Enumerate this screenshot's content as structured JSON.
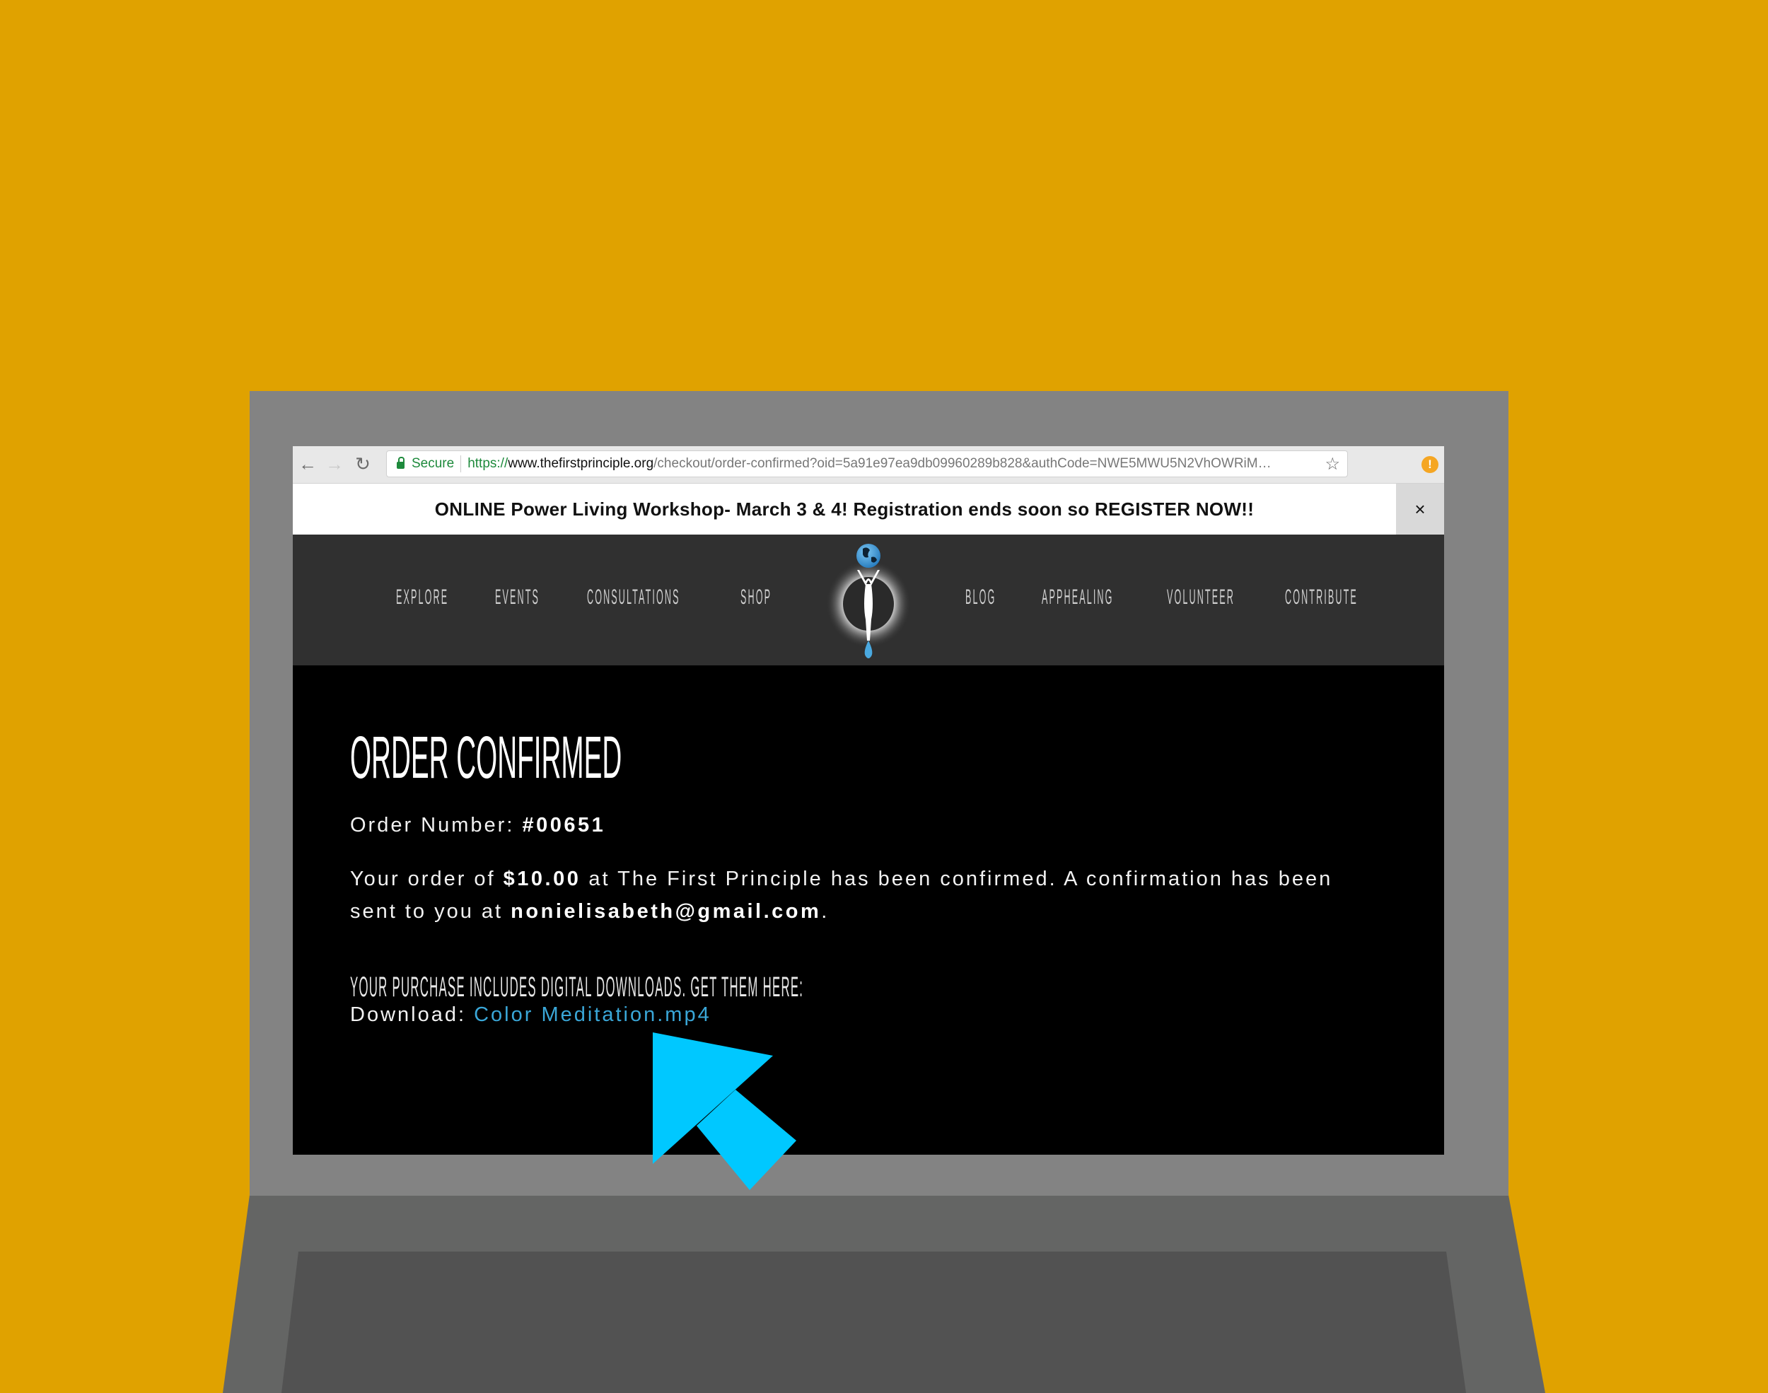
{
  "browser": {
    "back_icon": "arrow-left-icon",
    "forward_icon": "arrow-right-icon",
    "reload_icon": "reload-icon",
    "secure_label": "Secure",
    "url_scheme": "https://",
    "url_host": "www.thefirstprinciple.org",
    "url_path": "/checkout/order-confirmed?oid=5a91e97ea9db09960289b828&authCode=NWE5MWU5N2VhOWRiM…",
    "bookmark_icon": "star-icon",
    "alert_icon": "alert-icon",
    "alert_glyph": "!",
    "back_glyph": "←",
    "forward_glyph": "→",
    "reload_glyph": "↻",
    "star_glyph": "☆"
  },
  "announcement": {
    "text": "ONLINE Power Living Workshop- March 3 & 4! Registration ends soon so REGISTER NOW!!",
    "close_glyph": "×"
  },
  "nav": {
    "left": [
      "EXPLORE",
      "EVENTS",
      "CONSULTATIONS",
      "SHOP"
    ],
    "right": [
      "BLOG",
      "APPHEALING",
      "VOLUNTEER",
      "CONTRIBUTE"
    ],
    "logo_icon": "globe-figure-logo-icon"
  },
  "order": {
    "title": "ORDER CONFIRMED",
    "number_label": "Order Number: ",
    "number_value": "#00651",
    "msg_part1": "Your order of ",
    "amount": "$10.00",
    "msg_part2": " at The First Principle has been confirmed. A confirmation has been",
    "msg_part3": "sent to you at ",
    "email": "nonielisabeth@gmail.com",
    "msg_part4": ".",
    "downloads_heading": "YOUR PURCHASE INCLUDES DIGITAL DOWNLOADS. GET THEM HERE:",
    "download_label": "Download: ",
    "download_file": "Color Meditation.mp4"
  },
  "colors": {
    "background": "#E0A200",
    "bezel": "#838383",
    "base": "#646564",
    "keyboard": "#525252",
    "nav_bg": "#303030",
    "link": "#3aa7d8",
    "cursor": "#00C8FF",
    "secure_green": "#1e8a3c",
    "alert_orange": "#F5A623"
  }
}
